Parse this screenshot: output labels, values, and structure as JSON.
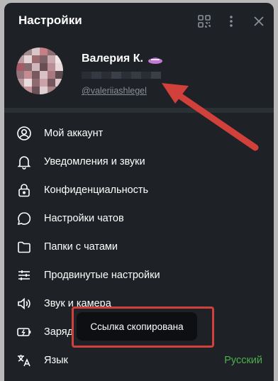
{
  "header": {
    "title": "Настройки",
    "icons": [
      "qr-code-icon",
      "more-vert-icon",
      "close-icon"
    ]
  },
  "profile": {
    "name": "Валерия К.",
    "username": "@valeriiashlegel",
    "phone": "",
    "badge_icon": "premium-emoji-icon"
  },
  "menu": [
    {
      "icon": "user-circle-icon",
      "label": "Мой аккаунт"
    },
    {
      "icon": "bell-icon",
      "label": "Уведомления и звуки"
    },
    {
      "icon": "lock-icon",
      "label": "Конфиденциальность"
    },
    {
      "icon": "chat-bubble-icon",
      "label": "Настройки чатов"
    },
    {
      "icon": "folder-icon",
      "label": "Папки с чатами"
    },
    {
      "icon": "sliders-icon",
      "label": "Продвинутые настройки"
    },
    {
      "icon": "speaker-icon",
      "label": "Звук и камера"
    },
    {
      "icon": "battery-icon",
      "label": "Заряд батареи и анимации"
    },
    {
      "icon": "translate-icon",
      "label": "Язык",
      "value": "Русский"
    }
  ],
  "toast": {
    "text": "Ссылка скопирована"
  },
  "colors": {
    "panel_bg": "#1e2126",
    "text": "#ffffff",
    "muted": "#8a9097",
    "accent_green": "#4fae4e",
    "annotation_red": "#d2403b",
    "toast_bg": "#0d0f12"
  }
}
